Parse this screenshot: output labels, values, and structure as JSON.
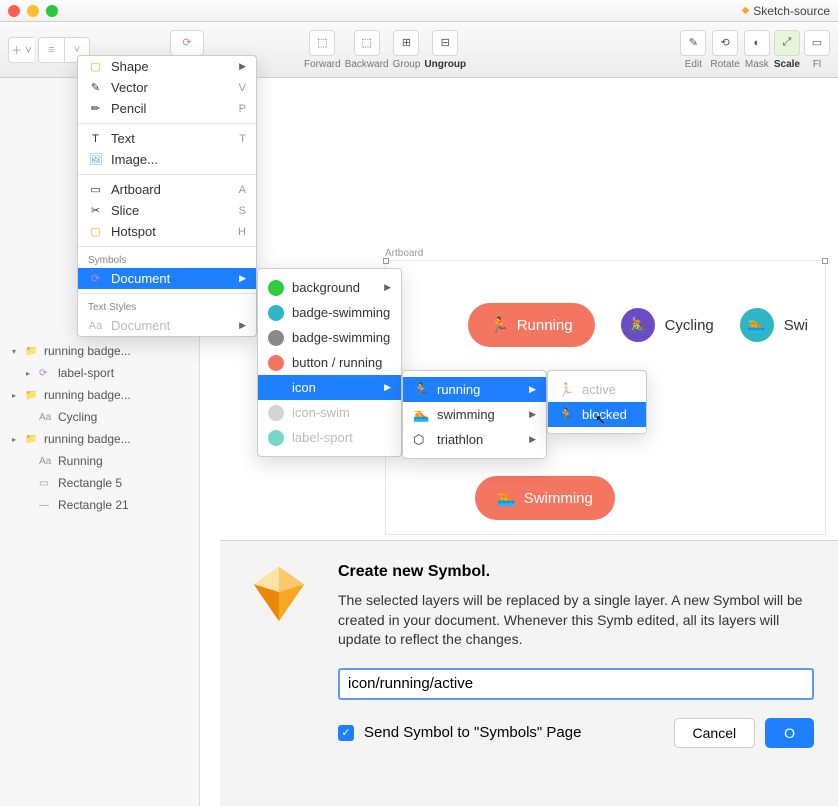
{
  "window": {
    "doc_name": "Sketch-source"
  },
  "toolbar": {
    "symbol": "Symbol",
    "forward": "Forward",
    "backward": "Backward",
    "group": "Group",
    "ungroup": "Ungroup",
    "edit": "Edit",
    "rotate": "Rotate",
    "mask": "Mask",
    "scale": "Scale",
    "flatten": "Fl"
  },
  "insert_menu": {
    "sections": [
      {
        "items": [
          {
            "icon": "shape-icon",
            "label": "Shape",
            "arrow": true
          },
          {
            "icon": "vector-icon",
            "label": "Vector",
            "key": "V"
          },
          {
            "icon": "pencil-icon",
            "label": "Pencil",
            "key": "P"
          }
        ]
      },
      {
        "items": [
          {
            "icon": "text-icon",
            "label": "Text",
            "key": "T"
          },
          {
            "icon": "image-icon",
            "label": "Image..."
          }
        ]
      },
      {
        "items": [
          {
            "icon": "artboard-icon",
            "label": "Artboard",
            "key": "A"
          },
          {
            "icon": "slice-icon",
            "label": "Slice",
            "key": "S"
          },
          {
            "icon": "hotspot-icon",
            "label": "Hotspot",
            "key": "H"
          }
        ]
      },
      {
        "header": "Symbols",
        "items": [
          {
            "icon": "document-icon",
            "label": "Document",
            "arrow": true,
            "selected": true
          }
        ]
      },
      {
        "header": "Text Styles",
        "items": [
          {
            "icon": "textstyle-icon",
            "label": "Document",
            "arrow": true,
            "dim": true
          }
        ]
      }
    ]
  },
  "submenu1": [
    {
      "label": "background",
      "color": "#2ecc40",
      "arrow": true
    },
    {
      "label": "badge-swimming",
      "color": "#2eb6c7"
    },
    {
      "label": "badge-swimming",
      "color": "#8a8a8a"
    },
    {
      "label": "button / running",
      "color": "#f47560"
    },
    {
      "label": "icon",
      "color": "#1f80ff",
      "arrow": true,
      "selected": true
    },
    {
      "label": "icon-swim",
      "color": "#d5d5d5",
      "dim": true
    },
    {
      "label": "label-sport",
      "color": "#76d7c4",
      "dim": true
    }
  ],
  "submenu2": [
    {
      "label": "running",
      "arrow": true,
      "selected": true,
      "glyph": "🏃"
    },
    {
      "label": "swimming",
      "arrow": true,
      "glyph": "🏊"
    },
    {
      "label": "triathlon",
      "arrow": true,
      "glyph": "⬡"
    }
  ],
  "submenu3": [
    {
      "label": "active",
      "dim": true
    },
    {
      "label": "blocked",
      "selected": true
    }
  ],
  "canvas": {
    "artboard_label": "Artboard",
    "pills": {
      "running": "Running",
      "cycling": "Cycling",
      "swimming_short": "Swi",
      "swimming": "Swimming"
    }
  },
  "layers": [
    {
      "icon": "folder",
      "label": "running badge...",
      "disc": true,
      "open": true,
      "ind": 0
    },
    {
      "icon": "symbol",
      "label": "label-sport",
      "disc": true,
      "ind": 1,
      "color": "#c77dd8"
    },
    {
      "icon": "folder",
      "label": "running badge...",
      "disc": true,
      "ind": 0
    },
    {
      "icon": "aa",
      "label": "Cycling",
      "ind": 1
    },
    {
      "icon": "folder",
      "label": "running badge...",
      "disc": true,
      "ind": 0
    },
    {
      "icon": "aa",
      "label": "Running",
      "ind": 1
    },
    {
      "icon": "rect",
      "label": "Rectangle 5",
      "ind": 1
    },
    {
      "icon": "line",
      "label": "Rectangle 21",
      "ind": 1
    }
  ],
  "dialog": {
    "title": "Create new Symbol.",
    "body": "The selected layers will be replaced by a single layer. A new Symbol will be created in your document. Whenever this Symb edited, all its layers will update to reflect the changes.",
    "input_value": "icon/running/active",
    "checkbox_label": "Send Symbol to \"Symbols\" Page",
    "checkbox_checked": true,
    "cancel": "Cancel",
    "ok": "O"
  }
}
